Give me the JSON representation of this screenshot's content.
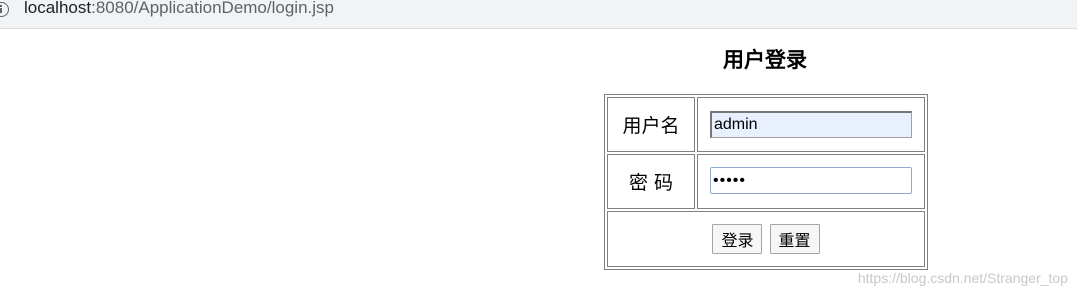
{
  "browser": {
    "url_host": "localhost",
    "url_rest": ":8080/ApplicationDemo/login.jsp",
    "info_icon": "info-icon"
  },
  "form": {
    "title": "用户登录",
    "username_label": "用户名",
    "username_value": "admin",
    "password_label": "密 码",
    "password_value": "•••••",
    "login_button": "登录",
    "reset_button": "重置"
  },
  "watermark": "https://blog.csdn.net/Stranger_top"
}
